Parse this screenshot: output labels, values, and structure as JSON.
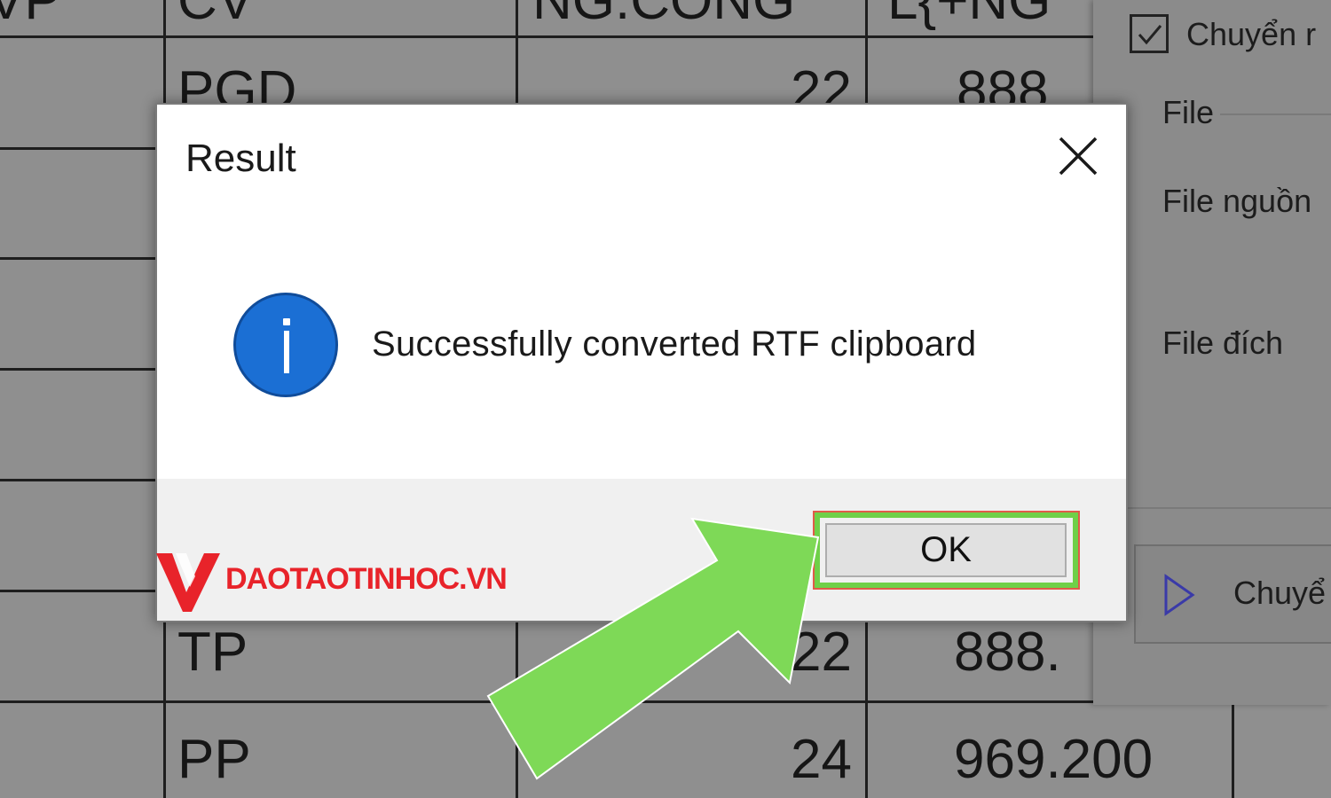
{
  "sheet": {
    "headers": [
      "VP",
      "CV",
      "NG.CÔNG",
      "L{+NG"
    ],
    "rows": [
      {
        "cv": "PGD",
        "ngcong": "22",
        "luong": "888"
      },
      {
        "cv": "TP",
        "ngcong": "22",
        "luong": "888."
      },
      {
        "cv": "PP",
        "ngcong": "24",
        "luong": "969.200"
      }
    ]
  },
  "panel": {
    "checkbox_label": "Chuyển r",
    "file_label": "File",
    "source_label": "File nguồn",
    "dest_label": "File đích",
    "convert_label": "Chuyể"
  },
  "dialog": {
    "title": "Result",
    "message": "Successfully converted RTF clipboard",
    "ok_label": "OK",
    "icon": "info-icon"
  },
  "watermark": {
    "text": "DAOTAOTINHOC.VN",
    "color": "#e8232a"
  },
  "annotation": {
    "arrow_color": "#7ed957",
    "highlight_color": "#6fd048"
  }
}
